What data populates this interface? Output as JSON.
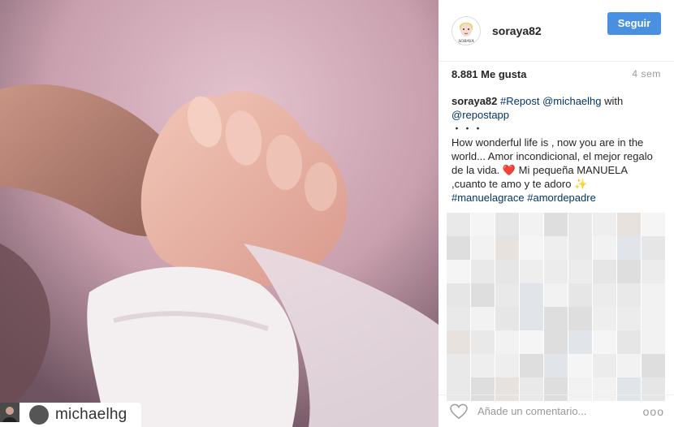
{
  "post": {
    "author_username": "soraya82",
    "follow_label": "Seguir",
    "likes_text": "8.881 Me gusta",
    "time_ago": "4 sem",
    "caption": {
      "username": "soraya82",
      "line1_tag1": "#Repost",
      "line1_mention": "@michaelhg",
      "line1_with": "with",
      "line2_mention": "@repostapp",
      "dots": "・・・",
      "body_text": "How wonderful life is , now you are in the world... Amor incondicional, el mejor regalo de la vida. ❤️ Mi pequeña MANUELA ,cuanto te amo y te adoro ✨",
      "hashtag1": "#manuelagrace",
      "hashtag2": "#amordepadre"
    },
    "comment_placeholder": "Añade un comentario...",
    "more_label": "ooo"
  },
  "photo": {
    "repost_username": "michaelhg",
    "avatar_caption": "SORAYA"
  },
  "icons": {
    "repost": "repost-icon",
    "heart": "heart-icon",
    "more": "more-options-icon"
  },
  "colors": {
    "follow_button": "#4a90e2",
    "hashtag": "#003569",
    "muted": "#999999"
  }
}
